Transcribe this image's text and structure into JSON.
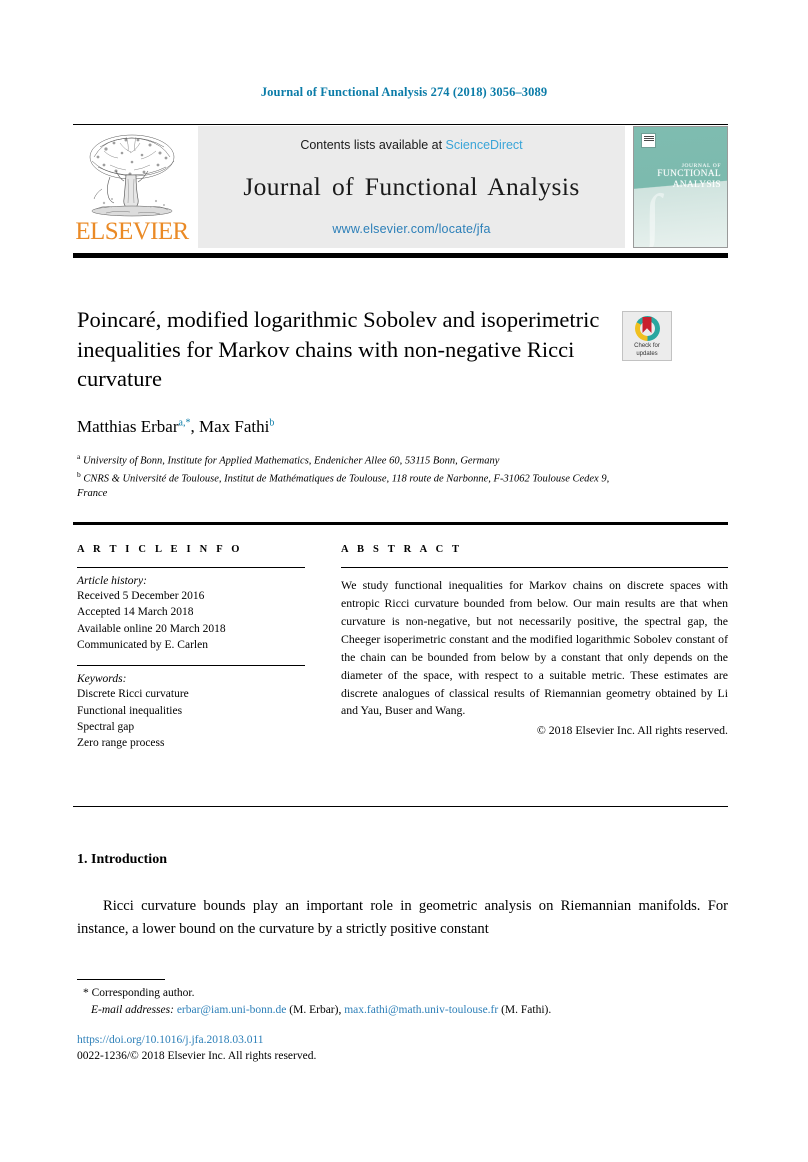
{
  "running_head": "Journal of Functional Analysis 274 (2018) 3056–3089",
  "masthead": {
    "publisher_name": "ELSEVIER",
    "publisher_logo_alt": "elsevier-tree-logo",
    "contents_prefix": "Contents lists available at ",
    "contents_link": "ScienceDirect",
    "journal_title": "Journal of Functional Analysis",
    "journal_url": "www.elsevier.com/locate/jfa",
    "cover": {
      "line1": "JOURNAL OF",
      "line2": "FUNCTIONAL",
      "line3": "ANALYSIS",
      "accent_color": "#7fbcb0"
    }
  },
  "article": {
    "title": "Poincaré, modified logarithmic Sobolev and isoperimetric inequalities for Markov chains with non-negative Ricci curvature",
    "crossmark": {
      "line1": "Check for",
      "line2": "updates"
    },
    "authors": [
      {
        "name": "Matthias Erbar",
        "marks": "a,*"
      },
      {
        "name": "Max Fathi",
        "marks": "b"
      }
    ],
    "affiliations": [
      {
        "mark": "a",
        "text": "University of Bonn, Institute for Applied Mathematics, Endenicher Allee 60, 53115 Bonn, Germany"
      },
      {
        "mark": "b",
        "text": "CNRS & Université de Toulouse, Institut de Mathématiques de Toulouse, 118 route de Narbonne, F-31062 Toulouse Cedex 9, France"
      }
    ]
  },
  "article_info": {
    "heading": "A R T I C L E   I N F O",
    "history_label": "Article history:",
    "history": [
      "Received 5 December 2016",
      "Accepted 14 March 2018",
      "Available online 20 March 2018",
      "Communicated by E. Carlen"
    ],
    "keywords_label": "Keywords:",
    "keywords": [
      "Discrete Ricci curvature",
      "Functional inequalities",
      "Spectral gap",
      "Zero range process"
    ]
  },
  "abstract": {
    "heading": "A B S T R A C T",
    "body": "We study functional inequalities for Markov chains on discrete spaces with entropic Ricci curvature bounded from below. Our main results are that when curvature is non-negative, but not necessarily positive, the spectral gap, the Cheeger isoperimetric constant and the modified logarithmic Sobolev constant of the chain can be bounded from below by a constant that only depends on the diameter of the space, with respect to a suitable metric. These estimates are discrete analogues of classical results of Riemannian geometry obtained by Li and Yau, Buser and Wang.",
    "copyright": "© 2018 Elsevier Inc. All rights reserved."
  },
  "body": {
    "section_heading": "1.  Introduction",
    "first_paragraph": "Ricci curvature bounds play an important role in geometric analysis on Riemannian manifolds. For instance, a lower bound on the curvature by a strictly positive constant"
  },
  "footer": {
    "corresponding_note": "Corresponding author.",
    "corresponding_mark": "*",
    "email_label": "E-mail addresses:",
    "email_1": "erbar@iam.uni-bonn.de",
    "email_1_author": "(M. Erbar),",
    "email_2": "max.fathi@math.univ-toulouse.fr",
    "email_2_author": "(M. Fathi).",
    "doi": "https://doi.org/10.1016/j.jfa.2018.03.011",
    "issn_line": "0022-1236/© 2018 Elsevier Inc. All rights reserved."
  }
}
